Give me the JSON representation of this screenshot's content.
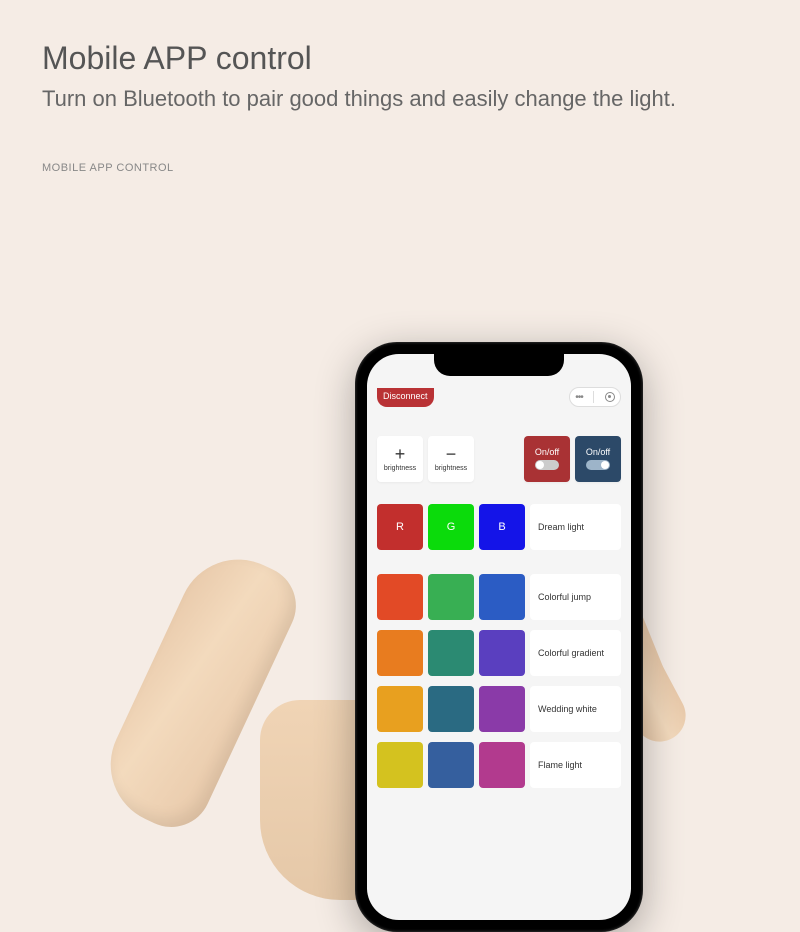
{
  "page": {
    "title": "Mobile APP control",
    "subtitle": "Turn on Bluetooth to pair good things and easily change the light.",
    "caption": "MOBILE APP CONTROL"
  },
  "topbar": {
    "disconnect": "Disconnect"
  },
  "controls": {
    "brightness_up_symbol": "+",
    "brightness_up_label": "brightness",
    "brightness_down_symbol": "−",
    "brightness_down_label": "brightness",
    "onoff1": "On/off",
    "onoff2": "On/off"
  },
  "rgb": {
    "r": "R",
    "g": "G",
    "b": "B",
    "dream": "Dream light"
  },
  "effects": {
    "e1": "Colorful jump",
    "e2": "Colorful gradient",
    "e3": "Wedding white",
    "e4": "Flame light"
  },
  "colors": {
    "r": "#c22f2d",
    "g": "#0bdb0b",
    "b": "#1414e8",
    "grid": [
      [
        "#e24a26",
        "#38af53",
        "#2b5cc4"
      ],
      [
        "#e87c1f",
        "#2b8a72",
        "#5a3fbf"
      ],
      [
        "#e8a01f",
        "#2a6a82",
        "#8a3aa8"
      ],
      [
        "#d4c21f",
        "#355f9e",
        "#b23a8e"
      ]
    ]
  }
}
